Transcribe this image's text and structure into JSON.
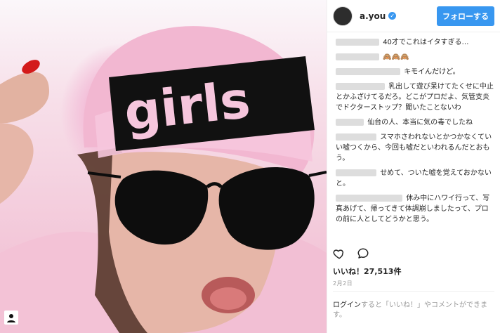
{
  "photo": {
    "beanie_text": "girls"
  },
  "header": {
    "username": "a.you",
    "verified_icon": "verified-check-icon",
    "follow_label": "フォローする"
  },
  "comments": [
    {
      "text": "40才でこれはイタすぎる…"
    },
    {
      "text": "🙈🙈🙈"
    },
    {
      "text": "キモイんだけど。"
    },
    {
      "text": "乳出して遊び呆けてたくせに中止とかふざけてるだろ。どこがプロだよ、気管支炎でドクターストップ？聞いたことないわ"
    },
    {
      "text": "仙台の人、本当に気の毒でしたね"
    },
    {
      "text": "スマホさわれないとかつかなくていい嘘つくから、今回も嘘だといわれるんだとおもう。"
    },
    {
      "text": "せめて、ついた嘘を覚えておかないと。"
    },
    {
      "text": "休み中にハワイ行って、写真あげて、帰ってきて体調崩しましたって、プロの前に人としてどうかと思う。"
    }
  ],
  "actions": {
    "like_icon": "heart-icon",
    "comment_icon": "comment-icon"
  },
  "likes_text": "いいね！27,513件",
  "date_text": "2月2日",
  "login": {
    "link": "ログイン",
    "text": "すると「いいね！」やコメントができます。"
  }
}
